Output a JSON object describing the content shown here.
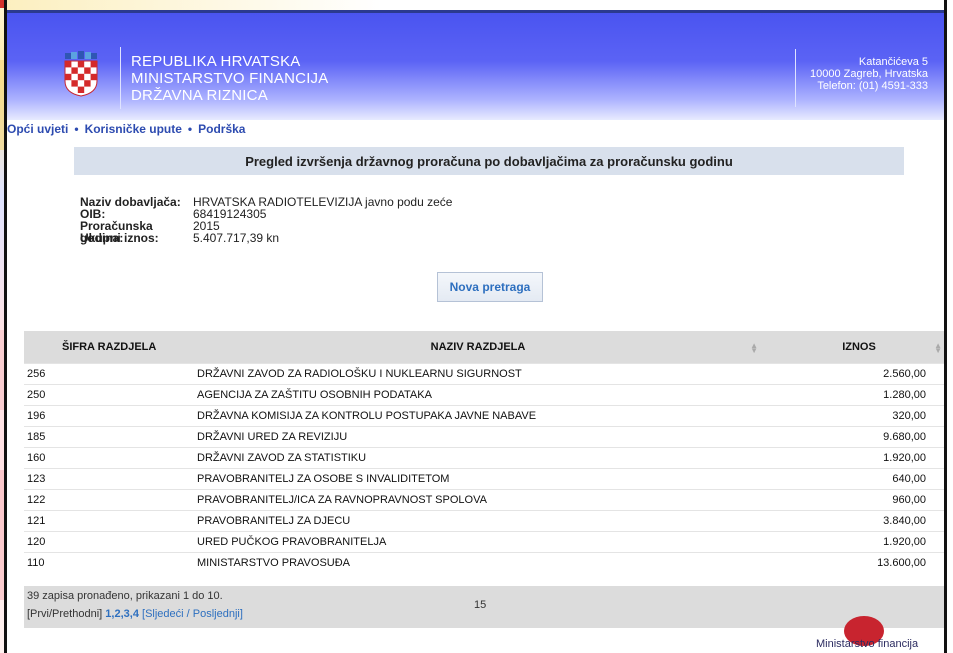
{
  "header": {
    "org_line1": "REPUBLIKA HRVATSKA",
    "org_line2": "MINISTARSTVO FINANCIJA",
    "org_line3": "DRŽAVNA RIZNICA",
    "address_line1": "Katančićeva 5",
    "address_line2": "10000 Zagreb, Hrvatska",
    "address_line3": "Telefon: (01) 4591-333"
  },
  "nav": {
    "terms": "Opći uvjeti",
    "manual": "Korisničke upute",
    "support": "Podrška",
    "sep": "•"
  },
  "title": "Pregled izvršenja državnog proračuna po dobavljačima za proračunsku godinu",
  "info": {
    "supplier_label": "Naziv dobavljača:",
    "supplier_value": "HRVATSKA RADIOTELEVIZIJA javno podu zeće",
    "oib_label": "OIB:",
    "oib_value": "68419124305",
    "year_label": "Proračunska godina:",
    "year_value": "2015",
    "total_label": "Ukupni iznos:",
    "total_value": "5.407.717,39 kn"
  },
  "new_search_label": "Nova pretraga",
  "table": {
    "headers": [
      "ŠIFRA RAZDJELA",
      "NAZIV RAZDJELA",
      "IZNOS"
    ],
    "rows": [
      [
        "256",
        "DRŽAVNI ZAVOD ZA RADIOLOŠKU I NUKLEARNU SIGURNOST",
        "2.560,00"
      ],
      [
        "250",
        "AGENCIJA ZA ZAŠTITU OSOBNIH PODATAKA",
        "1.280,00"
      ],
      [
        "196",
        "DRŽAVNA KOMISIJA ZA KONTROLU POSTUPAKA JAVNE NABAVE",
        "320,00"
      ],
      [
        "185",
        "DRŽAVNI URED ZA REVIZIJU",
        "9.680,00"
      ],
      [
        "160",
        "DRŽAVNI ZAVOD ZA STATISTIKU",
        "1.920,00"
      ],
      [
        "123",
        "PRAVOBRANITELJ ZA OSOBE S INVALIDITETOM",
        "640,00"
      ],
      [
        "122",
        "PRAVOBRANITELJ/ICA ZA RAVNOPRAVNOST SPOLOVA",
        "960,00"
      ],
      [
        "121",
        "PRAVOBRANITELJ ZA DJECU",
        "3.840,00"
      ],
      [
        "120",
        "URED PUČKOG PRAVOBRANITELJA",
        "1.920,00"
      ],
      [
        "110",
        "MINISTARSTVO PRAVOSUĐA",
        "13.600,00"
      ]
    ]
  },
  "footer": {
    "records_text": "39 zapisa pronađeno, prikazani 1 do 10.",
    "first_prev": "[Prvi/Prethodni]",
    "page1": "1",
    "page2": "2",
    "page3": "3",
    "page4": "4",
    "next": "Sljedeći",
    "last": "Posljednji",
    "page_size": "15"
  },
  "bottom_logo_text": "Ministarstvo financija"
}
